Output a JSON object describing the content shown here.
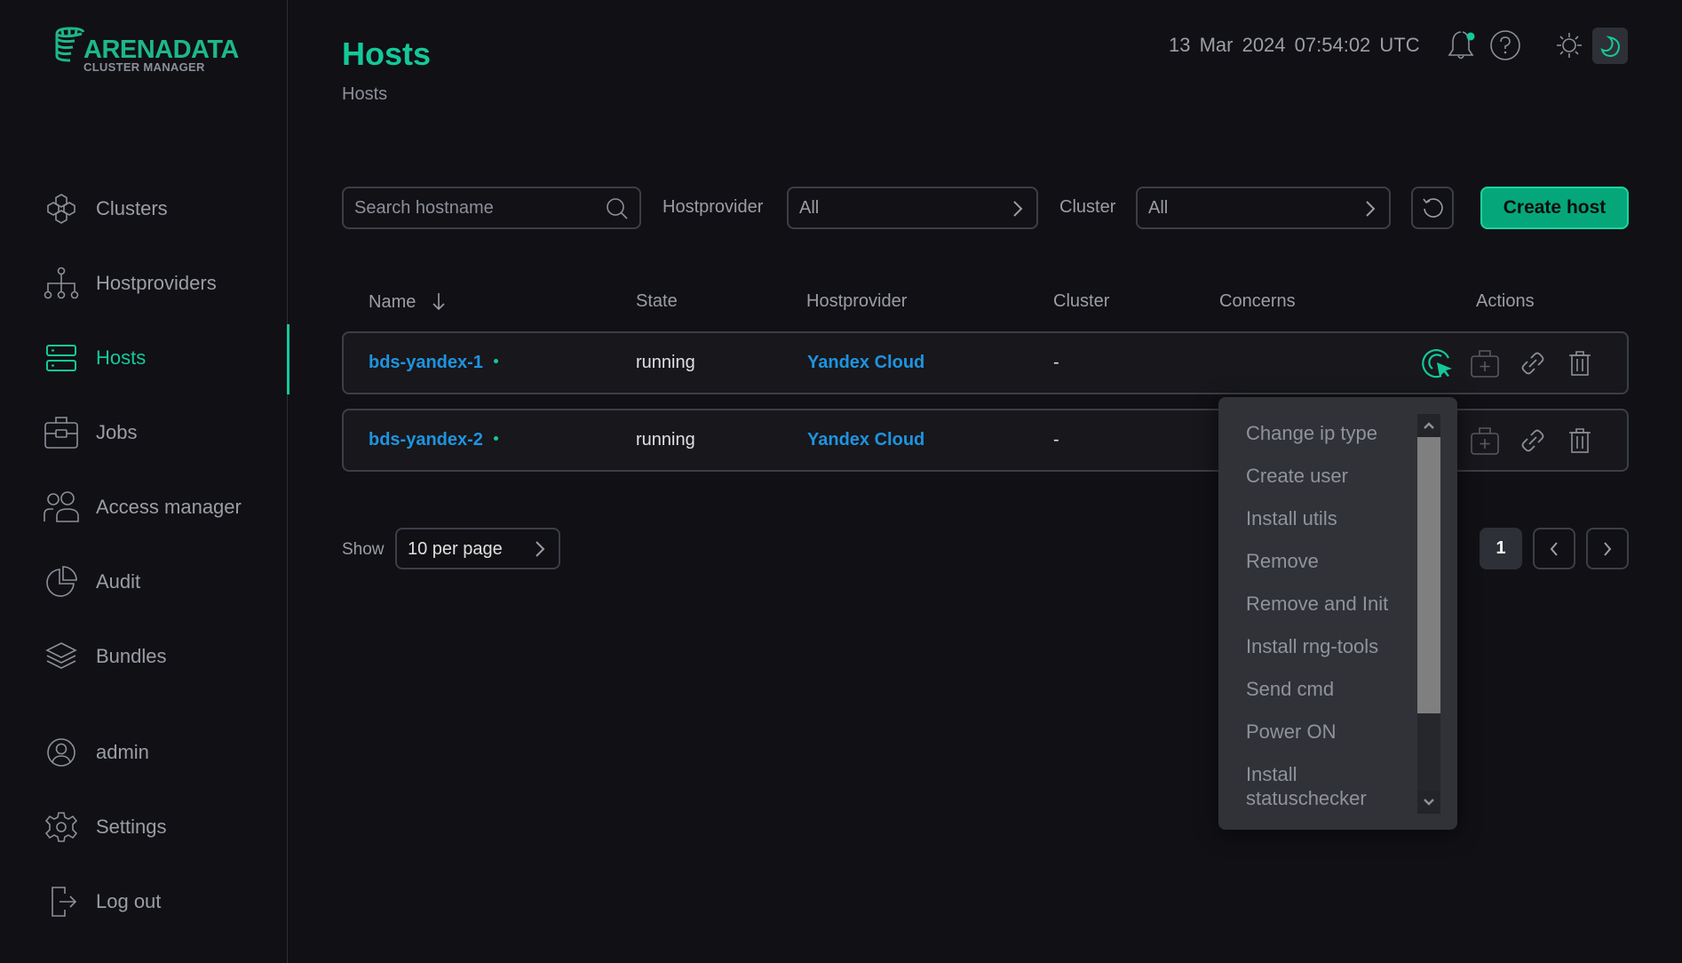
{
  "app": {
    "logo_title": "ARENADATA",
    "logo_subtitle": "CLUSTER MANAGER"
  },
  "sidebar": {
    "items": [
      {
        "label": "Clusters",
        "icon": "clusters-icon",
        "active": false
      },
      {
        "label": "Hostproviders",
        "icon": "hostproviders-icon",
        "active": false
      },
      {
        "label": "Hosts",
        "icon": "hosts-icon",
        "active": true
      },
      {
        "label": "Jobs",
        "icon": "jobs-icon",
        "active": false
      },
      {
        "label": "Access manager",
        "icon": "access-manager-icon",
        "active": false
      },
      {
        "label": "Audit",
        "icon": "audit-icon",
        "active": false
      },
      {
        "label": "Bundles",
        "icon": "bundles-icon",
        "active": false
      }
    ],
    "bottom_items": [
      {
        "label": "admin",
        "icon": "user-icon"
      },
      {
        "label": "Settings",
        "icon": "gear-icon"
      },
      {
        "label": "Log out",
        "icon": "logout-icon"
      }
    ]
  },
  "header": {
    "title": "Hosts",
    "breadcrumb": "Hosts",
    "date": "13 Mar 2024",
    "time": "07:54:02",
    "timezone": "UTC",
    "notification_indicator": true,
    "theme": "dark"
  },
  "filters": {
    "search_placeholder": "Search hostname",
    "search_value": "",
    "hostprovider_label": "Hostprovider",
    "hostprovider_value": "All",
    "cluster_label": "Cluster",
    "cluster_value": "All",
    "create_button": "Create host"
  },
  "table": {
    "columns": [
      "Name",
      "State",
      "Hostprovider",
      "Cluster",
      "Concerns",
      "Actions"
    ],
    "sort": {
      "column": "Name",
      "direction": "desc"
    },
    "rows": [
      {
        "name": "bds-yandex-1",
        "state": "running",
        "hostprovider": "Yandex Cloud",
        "cluster": "-",
        "concerns": ""
      },
      {
        "name": "bds-yandex-2",
        "state": "running",
        "hostprovider": "Yandex Cloud",
        "cluster": "-",
        "concerns": ""
      }
    ]
  },
  "actions_menu": {
    "open_for_row": "bds-yandex-1",
    "items": [
      "Change ip type",
      "Create user",
      "Install utils",
      "Remove",
      "Remove and Init",
      "Install rng-tools",
      "Send cmd",
      "Power ON",
      "Install statuschecker"
    ]
  },
  "pagination": {
    "show_label": "Show",
    "per_page": "10 per page",
    "current_page": "1"
  },
  "colors": {
    "accent": "#14c89a",
    "link": "#1e94e0",
    "background": "#111014",
    "button": "#05a77a"
  }
}
